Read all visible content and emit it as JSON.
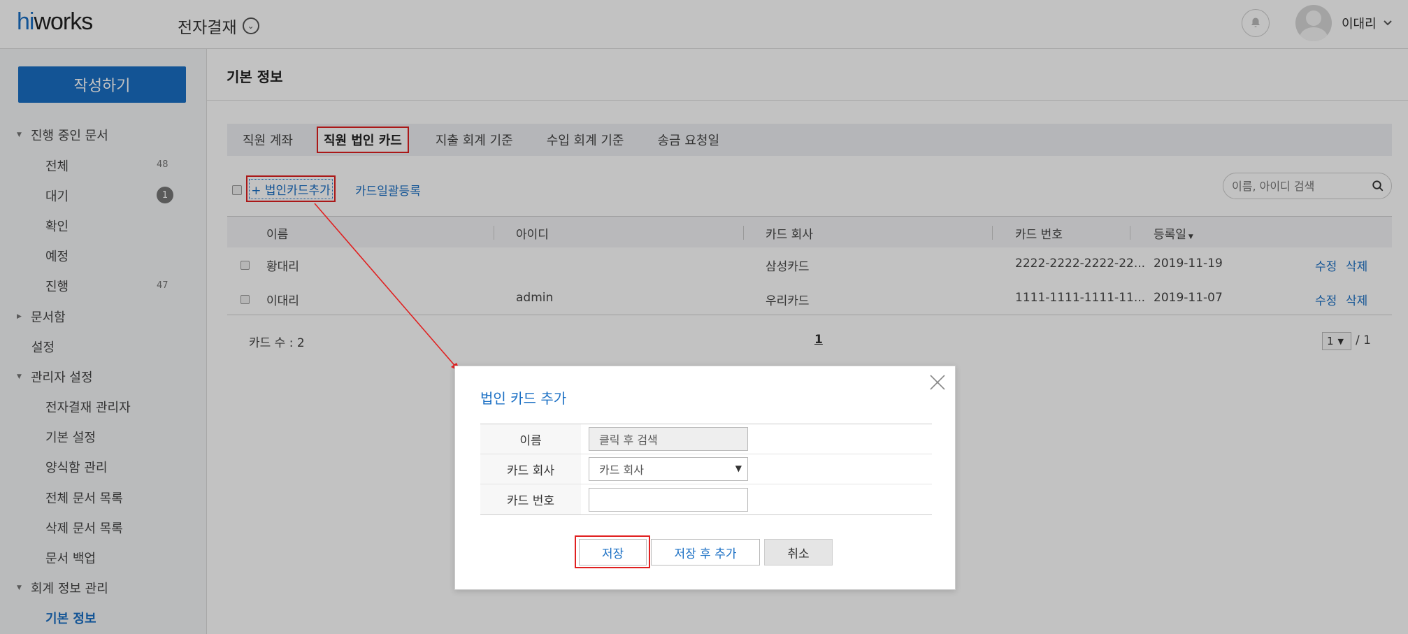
{
  "header": {
    "logo_hi": "hi",
    "logo_rest": "works",
    "app_title": "전자결재",
    "user_name": "이대리"
  },
  "sidebar": {
    "compose": "작성하기",
    "items": [
      {
        "label": "진행 중인 문서"
      },
      {
        "label": "전체",
        "count": "48"
      },
      {
        "label": "대기",
        "badge": "1"
      },
      {
        "label": "확인"
      },
      {
        "label": "예정"
      },
      {
        "label": "진행",
        "count": "47"
      },
      {
        "label": "문서함"
      },
      {
        "label": "설정"
      },
      {
        "label": "관리자 설정"
      },
      {
        "label": "전자결재 관리자"
      },
      {
        "label": "기본 설정"
      },
      {
        "label": "양식함 관리"
      },
      {
        "label": "전체 문서 목록"
      },
      {
        "label": "삭제 문서 목록"
      },
      {
        "label": "문서 백업"
      },
      {
        "label": "회계 정보 관리"
      },
      {
        "label": "기본 정보"
      }
    ]
  },
  "main": {
    "title": "기본 정보",
    "tabs": [
      {
        "label": "직원 계좌"
      },
      {
        "label": "직원 법인 카드"
      },
      {
        "label": "지출 회계 기준"
      },
      {
        "label": "수입 회계 기준"
      },
      {
        "label": "송금 요청일"
      }
    ],
    "add_card": "+ 법인카드추가",
    "bulk_register": "카드일괄등록",
    "search_placeholder": "이름, 아이디 검색",
    "columns": [
      "이름",
      "아이디",
      "카드 회사",
      "카드 번호",
      "등록일"
    ],
    "rows": [
      {
        "name": "황대리",
        "id": "",
        "company": "삼성카드",
        "card_no": "2222-2222-2222-22...",
        "date": "2019-11-19",
        "edit": "수정",
        "delete": "삭제"
      },
      {
        "name": "이대리",
        "id": "admin",
        "company": "우리카드",
        "card_no": "1111-1111-1111-11...",
        "date": "2019-11-07",
        "edit": "수정",
        "delete": "삭제"
      }
    ],
    "card_count": "카드 수 : 2",
    "page": "1",
    "page_select": "1",
    "page_total": "/ 1"
  },
  "modal": {
    "title": "법인 카드 추가",
    "fields": [
      {
        "label": "이름",
        "placeholder": "클릭 후 검색"
      },
      {
        "label": "카드 회사",
        "value": "카드 회사"
      },
      {
        "label": "카드 번호",
        "value": ""
      }
    ],
    "save": "저장",
    "save_add": "저장 후 추가",
    "cancel": "취소"
  },
  "colors": {
    "brand": "#1a6fc4",
    "highlight": "#e02020"
  }
}
